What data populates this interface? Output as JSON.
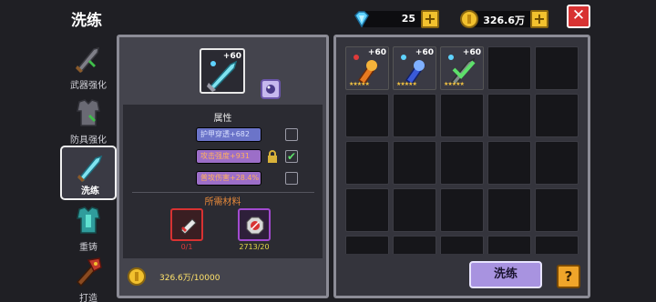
{
  "header": {
    "title": "洗练",
    "gems": "25",
    "gold": "326.6万",
    "plus": "+",
    "close": "✕"
  },
  "tabs": [
    {
      "label": "武器强化"
    },
    {
      "label": "防具强化"
    },
    {
      "label": "洗练"
    },
    {
      "label": "重铸"
    },
    {
      "label": "打造"
    }
  ],
  "selected_weapon": {
    "level": "+60"
  },
  "attributes": {
    "section_title": "属性",
    "items": [
      {
        "text": "护甲穿透+682",
        "locked": false,
        "checked": false
      },
      {
        "text": "攻击强度+931",
        "locked": true,
        "checked": true
      },
      {
        "text": "普攻伤害+28.4%",
        "locked": false,
        "checked": false
      }
    ],
    "checkmark": "✔"
  },
  "materials": {
    "section_title": "所需材料",
    "items": [
      {
        "count": "0/1"
      },
      {
        "count": "2713/20"
      }
    ]
  },
  "cost": {
    "text": "326.6万/10000"
  },
  "inventory": {
    "items": [
      {
        "level": "+60",
        "stars": "★★★★★"
      },
      {
        "level": "+60",
        "stars": "★★★★★"
      },
      {
        "level": "+60",
        "stars": "★★★★★"
      }
    ]
  },
  "buttons": {
    "refine": "洗练",
    "help": "?"
  },
  "colors": {
    "panel_bg": "#44444d",
    "accent_purple": "#a893e0",
    "gold": "#f2c12e",
    "close_red": "#d83232"
  }
}
